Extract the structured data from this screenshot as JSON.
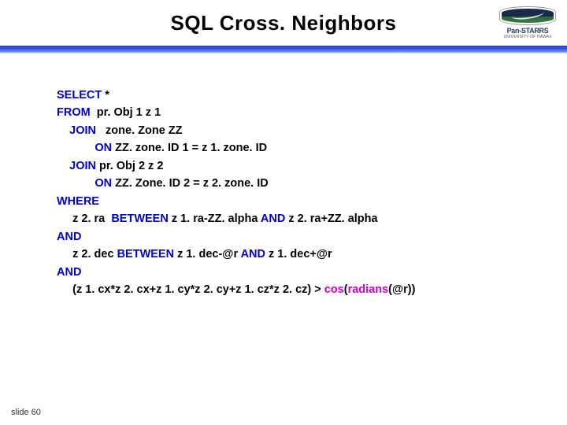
{
  "title": "SQL Cross. Neighbors",
  "logo": {
    "name": "Pan-STARRS",
    "subtitle": "UNIVERSITY OF HAWAII"
  },
  "sql": {
    "kw_select": "SELECT",
    "star": " * ",
    "kw_from": "FROM",
    "from_src": "  pr. Obj 1 z 1",
    "kw_join1": "JOIN",
    "join1_src": "   zone. Zone ZZ",
    "kw_on1": "ON",
    "on1_expr": " ZZ. zone. ID 1 = z 1. zone. ID",
    "kw_join2": "JOIN",
    "join2_src": " pr. Obj 2 z 2",
    "kw_on2": "ON",
    "on2_expr": " ZZ. Zone. ID 2 = z 2. zone. ID",
    "kw_where": "WHERE",
    "where_l1a": "     z 2. ra  ",
    "kw_between1": "BETWEEN",
    "where_l1b": " z 1. ra-ZZ. alpha ",
    "kw_and_inl1": "AND",
    "where_l1c": " z 2. ra+ZZ. alpha",
    "kw_and1": "AND",
    "where_l2a": "     z 2. dec ",
    "kw_between2": "BETWEEN",
    "where_l2b": " z 1. dec-@r ",
    "kw_and_inl2": "AND",
    "where_l2c": " z 1. dec+@r",
    "kw_and2": "AND",
    "where_l3a": "     (z 1. cx*z 2. cx+z 1. cy*z 2. cy+z 1. cz*z 2. cz) > ",
    "fn_cos": "cos",
    "paren1": "(",
    "fn_radians": "radians",
    "where_l3b": "(@r))"
  },
  "footer": "slide 60"
}
